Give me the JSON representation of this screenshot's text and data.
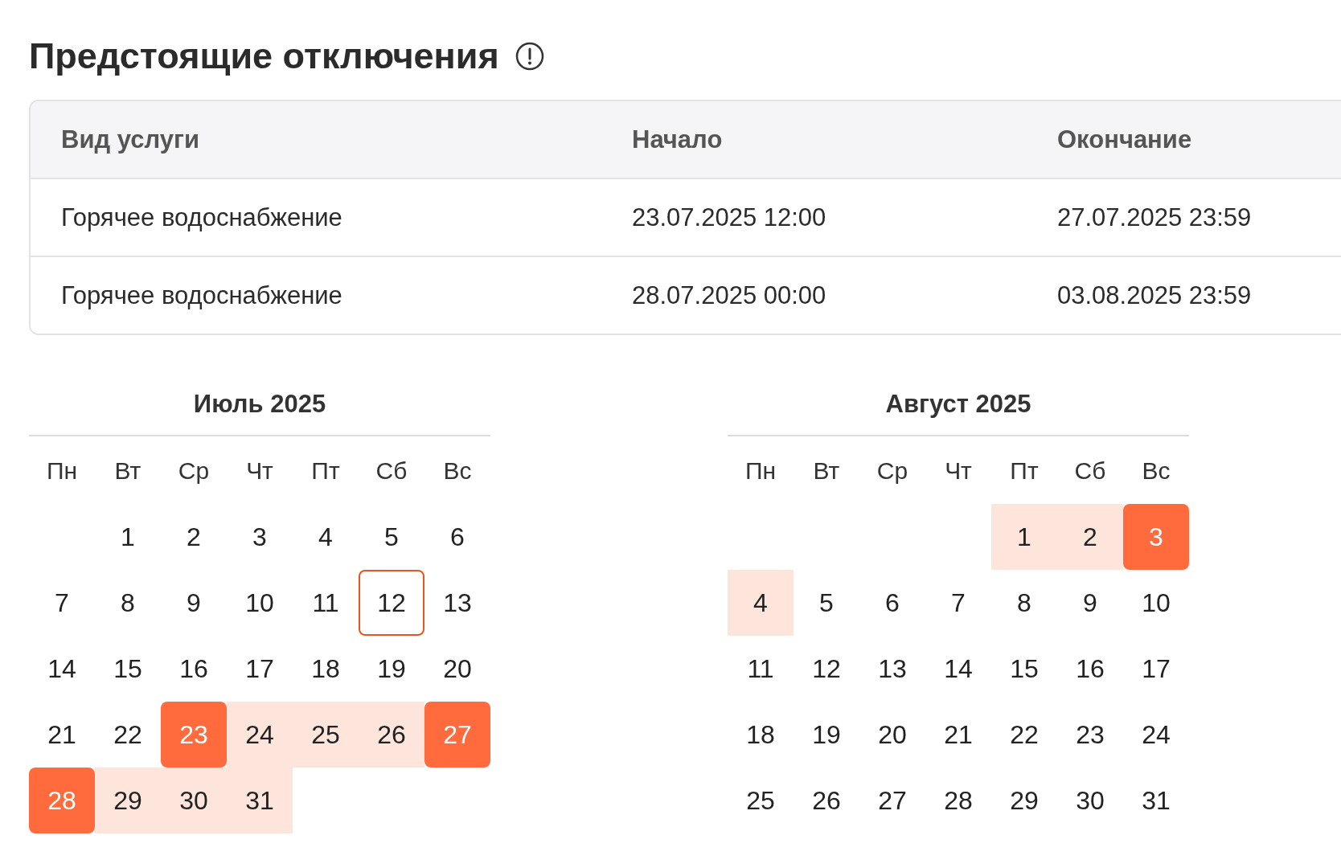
{
  "title": "Предстоящие отключения",
  "table": {
    "columns": [
      "Вид услуги",
      "Начало",
      "Окончание"
    ],
    "rows": [
      [
        "Горячее водоснабжение",
        "23.07.2025 12:00",
        "27.07.2025 23:59"
      ],
      [
        "Горячее водоснабжение",
        "28.07.2025 00:00",
        "03.08.2025 23:59"
      ]
    ]
  },
  "calendars": [
    {
      "title": "Июль 2025",
      "weekdays": [
        "Пн",
        "Вт",
        "Ср",
        "Чт",
        "Пт",
        "Сб",
        "Вс"
      ],
      "days": [
        {
          "kind": "blank"
        },
        {
          "day": "1",
          "kind": "plain"
        },
        {
          "day": "2",
          "kind": "plain"
        },
        {
          "day": "3",
          "kind": "plain"
        },
        {
          "day": "4",
          "kind": "plain"
        },
        {
          "day": "5",
          "kind": "plain"
        },
        {
          "day": "6",
          "kind": "plain"
        },
        {
          "day": "7",
          "kind": "plain"
        },
        {
          "day": "8",
          "kind": "plain"
        },
        {
          "day": "9",
          "kind": "plain"
        },
        {
          "day": "10",
          "kind": "plain"
        },
        {
          "day": "11",
          "kind": "plain"
        },
        {
          "day": "12",
          "kind": "today"
        },
        {
          "day": "13",
          "kind": "plain"
        },
        {
          "day": "14",
          "kind": "plain"
        },
        {
          "day": "15",
          "kind": "plain"
        },
        {
          "day": "16",
          "kind": "plain"
        },
        {
          "day": "17",
          "kind": "plain"
        },
        {
          "day": "18",
          "kind": "plain"
        },
        {
          "day": "19",
          "kind": "plain"
        },
        {
          "day": "20",
          "kind": "plain"
        },
        {
          "day": "21",
          "kind": "plain"
        },
        {
          "day": "22",
          "kind": "plain"
        },
        {
          "day": "23",
          "kind": "edge"
        },
        {
          "day": "24",
          "kind": "range"
        },
        {
          "day": "25",
          "kind": "range"
        },
        {
          "day": "26",
          "kind": "range"
        },
        {
          "day": "27",
          "kind": "edge"
        },
        {
          "day": "28",
          "kind": "edge"
        },
        {
          "day": "29",
          "kind": "range"
        },
        {
          "day": "30",
          "kind": "range"
        },
        {
          "day": "31",
          "kind": "range"
        }
      ]
    },
    {
      "title": "Август 2025",
      "weekdays": [
        "Пн",
        "Вт",
        "Ср",
        "Чт",
        "Пт",
        "Сб",
        "Вс"
      ],
      "days": [
        {
          "kind": "blank"
        },
        {
          "kind": "blank"
        },
        {
          "kind": "blank"
        },
        {
          "kind": "blank"
        },
        {
          "day": "1",
          "kind": "range"
        },
        {
          "day": "2",
          "kind": "range"
        },
        {
          "day": "3",
          "kind": "edge"
        },
        {
          "day": "4",
          "kind": "range"
        },
        {
          "day": "5",
          "kind": "plain"
        },
        {
          "day": "6",
          "kind": "plain"
        },
        {
          "day": "7",
          "kind": "plain"
        },
        {
          "day": "8",
          "kind": "plain"
        },
        {
          "day": "9",
          "kind": "plain"
        },
        {
          "day": "10",
          "kind": "plain"
        },
        {
          "day": "11",
          "kind": "plain"
        },
        {
          "day": "12",
          "kind": "plain"
        },
        {
          "day": "13",
          "kind": "plain"
        },
        {
          "day": "14",
          "kind": "plain"
        },
        {
          "day": "15",
          "kind": "plain"
        },
        {
          "day": "16",
          "kind": "plain"
        },
        {
          "day": "17",
          "kind": "plain"
        },
        {
          "day": "18",
          "kind": "plain"
        },
        {
          "day": "19",
          "kind": "plain"
        },
        {
          "day": "20",
          "kind": "plain"
        },
        {
          "day": "21",
          "kind": "plain"
        },
        {
          "day": "22",
          "kind": "plain"
        },
        {
          "day": "23",
          "kind": "plain"
        },
        {
          "day": "24",
          "kind": "plain"
        },
        {
          "day": "25",
          "kind": "plain"
        },
        {
          "day": "26",
          "kind": "plain"
        },
        {
          "day": "27",
          "kind": "plain"
        },
        {
          "day": "28",
          "kind": "plain"
        },
        {
          "day": "29",
          "kind": "plain"
        },
        {
          "day": "30",
          "kind": "plain"
        },
        {
          "day": "31",
          "kind": "plain"
        }
      ]
    }
  ]
}
